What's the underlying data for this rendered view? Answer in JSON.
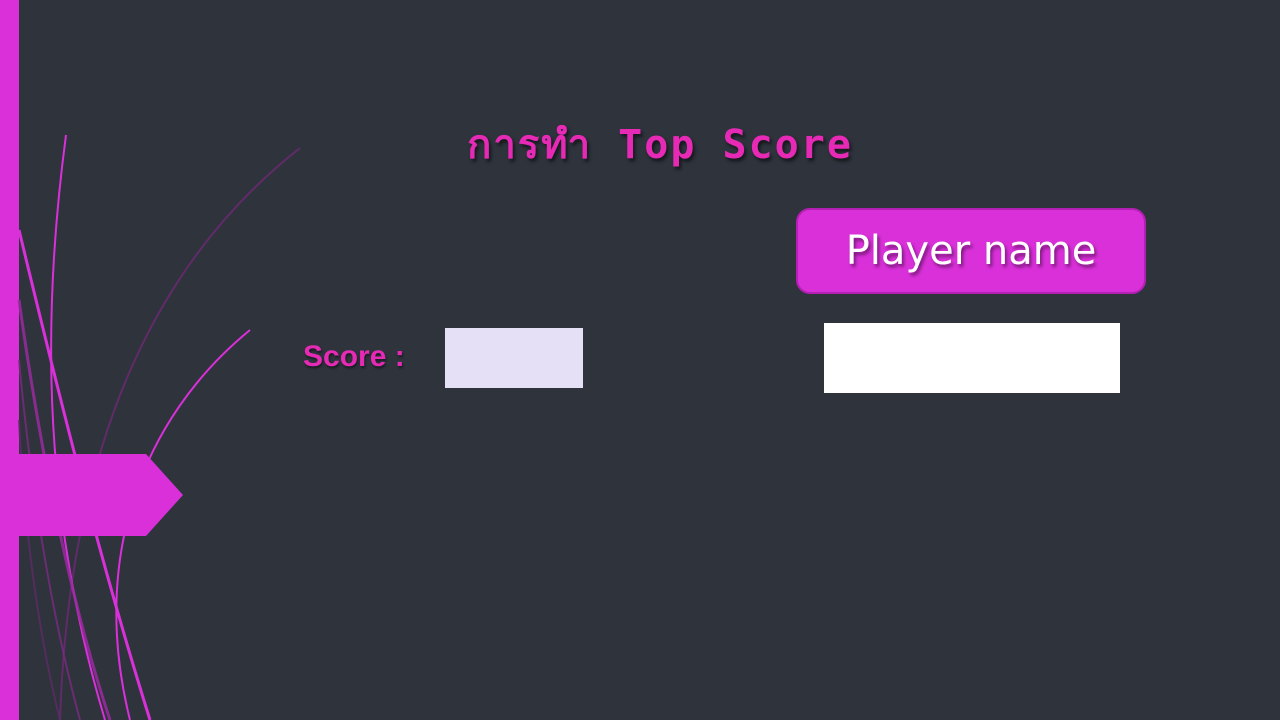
{
  "title": "การทำ Top Score",
  "score": {
    "label": "Score :",
    "value": ""
  },
  "player": {
    "button_label": "Player name",
    "input_value": "",
    "input_placeholder": ""
  },
  "colors": {
    "background": "#2e333c",
    "accent": "#d930d9",
    "title_text": "#e62ab5",
    "score_box": "#e5e0f5",
    "input_box": "#ffffff"
  }
}
